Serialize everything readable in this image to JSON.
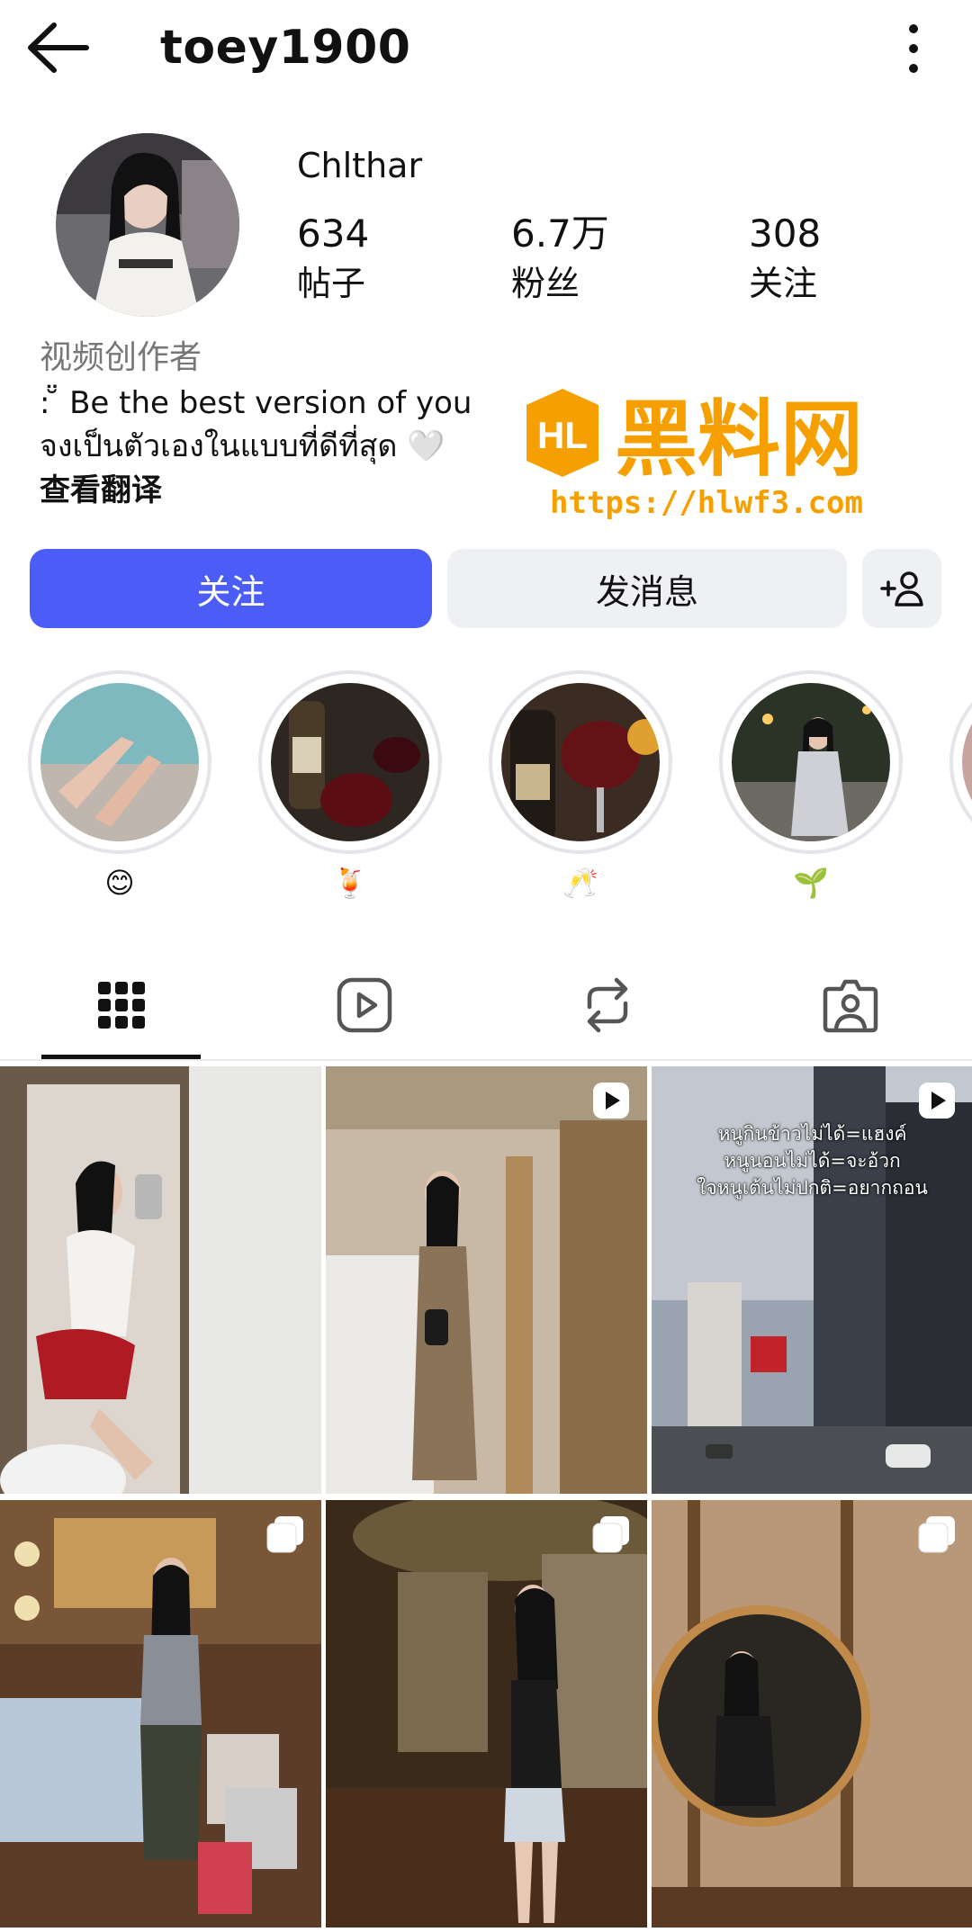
{
  "header": {
    "username": "toey1900",
    "back_icon": "arrow-left-icon",
    "more_icon": "vertical-dots-icon"
  },
  "profile": {
    "display_name": "Chlthar",
    "stats": {
      "posts_count": "634",
      "posts_label": "帖子",
      "followers_count": "6.7万",
      "followers_label": "粉丝",
      "following_count": "308",
      "following_label": "关注"
    },
    "bio": {
      "category": "视频创作者",
      "line1": ": ̆̈ Be the best version of you",
      "line2": "จงเป็นตัวเองในแบบที่ดีที่สุด 🤍",
      "translate": "查看翻译"
    }
  },
  "watermark": {
    "logo": "HL",
    "title": "黑料网",
    "url": "https://hlwf3.com"
  },
  "actions": {
    "follow_label": "关注",
    "message_label": "发消息",
    "suggest_icon": "add-person-icon"
  },
  "highlights": [
    {
      "label": "😊"
    },
    {
      "label": "🍹"
    },
    {
      "label": "🥂"
    },
    {
      "label": "🌱"
    }
  ],
  "tabs": [
    {
      "icon": "grid-icon",
      "active": true
    },
    {
      "icon": "reels-play-icon",
      "active": false
    },
    {
      "icon": "repost-icon",
      "active": false
    },
    {
      "icon": "tagged-person-icon",
      "active": false
    }
  ],
  "posts": [
    {
      "badge": "none"
    },
    {
      "badge": "reel-icon"
    },
    {
      "badge": "reel-icon",
      "caption": [
        "หนูกินข้าวไม่ได้=แฮงค์",
        "หนูนอนไม่ได้=จะอ้วก",
        "ใจหนูเต้นไม่ปกติ=อยากถอน"
      ]
    },
    {
      "badge": "carousel-icon"
    },
    {
      "badge": "carousel-icon"
    },
    {
      "badge": "carousel-icon"
    }
  ],
  "colors": {
    "follow_button": "#4c5cf7",
    "secondary_button": "#eff0f4",
    "watermark_orange": "#f5a000"
  }
}
